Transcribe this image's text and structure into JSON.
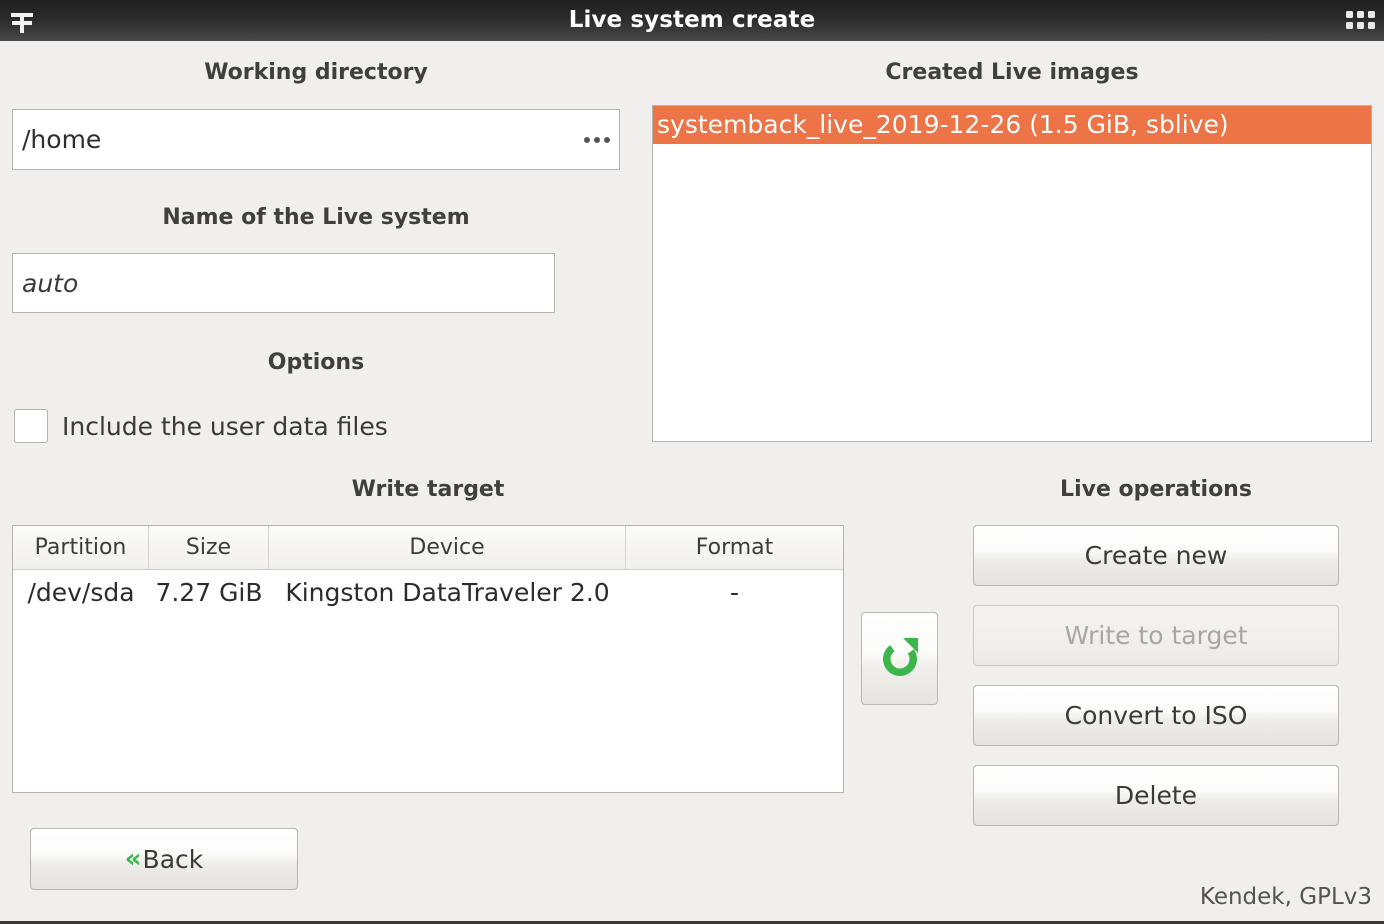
{
  "titlebar": {
    "title": "Live system create",
    "left_icon": "menu-plus-icon",
    "right_icon": "grid-dots-icon"
  },
  "working_directory": {
    "heading": "Working directory",
    "value": "/home",
    "browse_icon": "ellipsis-icon"
  },
  "live_name": {
    "heading": "Name of the Live system",
    "value": "auto",
    "is_placeholder": true
  },
  "options": {
    "heading": "Options",
    "include_user_data": {
      "label": "Include the user data files",
      "checked": false
    }
  },
  "created_live_images": {
    "heading": "Created Live images",
    "items": [
      {
        "label": "systemback_live_2019-12-26 (1.5 GiB, sblive)",
        "selected": true
      }
    ],
    "selection_color": "#ec7446"
  },
  "write_target": {
    "heading": "Write target",
    "columns": [
      "Partition",
      "Size",
      "Device",
      "Format"
    ],
    "rows": [
      {
        "partition": "/dev/sda",
        "size": "7.27 GiB",
        "device": "Kingston DataTraveler 2.0",
        "format": "-"
      }
    ]
  },
  "refresh": {
    "icon": "refresh-icon",
    "color": "#3cb54a"
  },
  "live_operations": {
    "heading": "Live operations",
    "buttons": [
      {
        "label": "Create new",
        "disabled": false
      },
      {
        "label": "Write to target",
        "disabled": true
      },
      {
        "label": "Convert to ISO",
        "disabled": false
      },
      {
        "label": "Delete",
        "disabled": false
      }
    ]
  },
  "back_button": {
    "label": "Back",
    "icon": "double-chevron-left-icon",
    "icon_glyph": "«"
  },
  "footer": {
    "text": "Kendek, GPLv3"
  }
}
